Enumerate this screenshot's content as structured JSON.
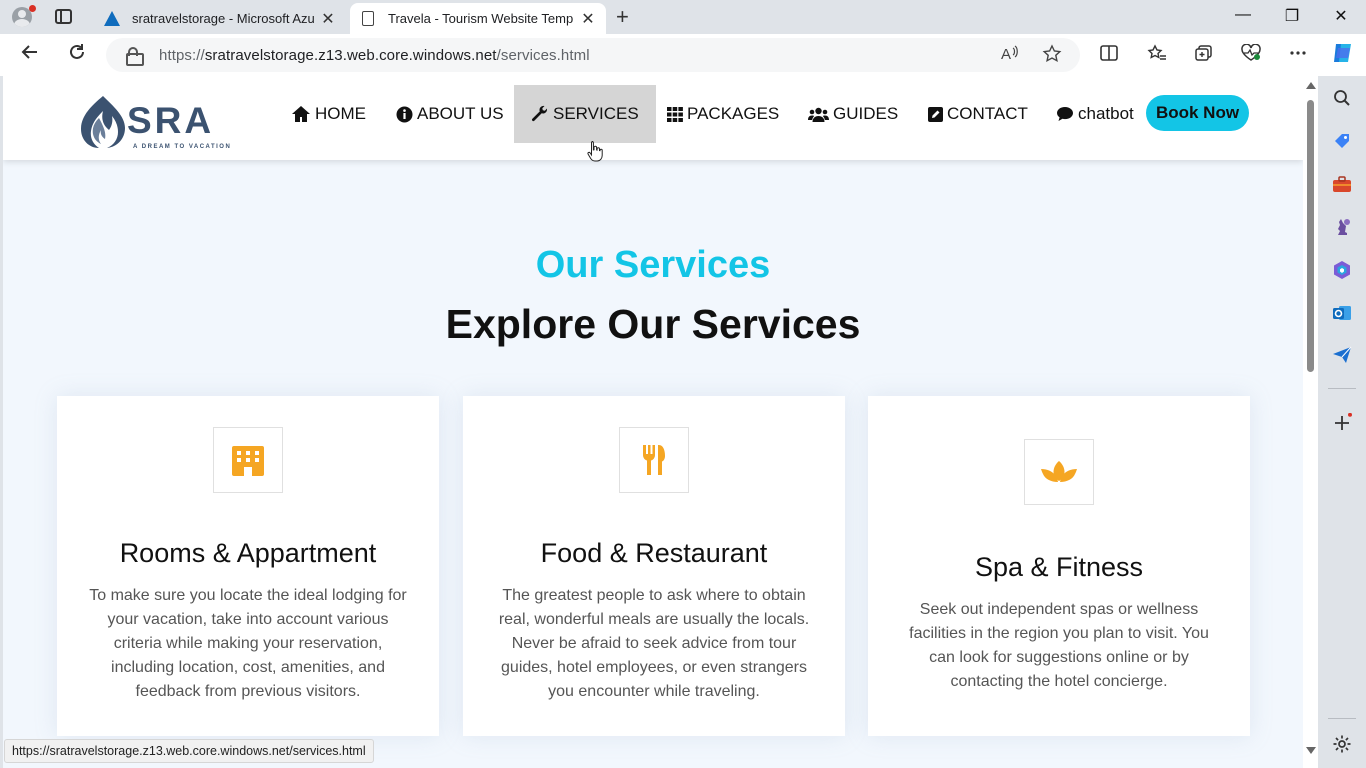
{
  "browser": {
    "tabs": [
      {
        "title": "sratravelstorage - Microsoft Azure",
        "close": "✕"
      },
      {
        "title": "Travela - Tourism Website Template",
        "close": "✕"
      }
    ],
    "new_tab": "+",
    "window_controls": {
      "minimize": "—",
      "restore": "❐",
      "close": "✕"
    },
    "url_prefix": "https://",
    "url_host": "sratravelstorage.z13.web.core.windows.net",
    "url_path": "/services.html",
    "status_url": "https://sratravelstorage.z13.web.core.windows.net/services.html"
  },
  "site": {
    "logo_text": "SRA",
    "logo_tagline": "A DREAM TO VACATION",
    "menu": [
      {
        "label": "HOME",
        "icon": "home-icon"
      },
      {
        "label": "ABOUT US",
        "icon": "info-icon"
      },
      {
        "label": "SERVICES",
        "icon": "wrench-icon",
        "active": true
      },
      {
        "label": "PACKAGES",
        "icon": "grid-icon"
      },
      {
        "label": "GUIDES",
        "icon": "users-icon"
      },
      {
        "label": "CONTACT",
        "icon": "edit-icon"
      },
      {
        "label": "chatbot",
        "icon": "comment-icon"
      }
    ],
    "book_now": "Book Now",
    "section": {
      "sub_heading": "Our Services",
      "heading": "Explore Our Services"
    },
    "services": [
      {
        "title": "Rooms & Appartment",
        "text": "To make sure you locate the ideal lodging for your vacation, take into account various criteria while making your reservation, including location, cost, amenities, and feedback from previous visitors.",
        "icon": "hotel-icon"
      },
      {
        "title": "Food & Restaurant",
        "text": "The greatest people to ask where to obtain real, wonderful meals are usually the locals. Never be afraid to seek advice from tour guides, hotel employees, or even strangers you encounter while traveling.",
        "icon": "utensils-icon"
      },
      {
        "title": "Spa & Fitness",
        "text": "Seek out independent spas or wellness facilities in the region you plan to visit. You can look for suggestions online or by contacting the hotel concierge.",
        "icon": "spa-icon"
      }
    ],
    "colors": {
      "accent": "#13c5e6",
      "icon_orange": "#f5a623",
      "logo_navy": "#3b5270"
    }
  }
}
